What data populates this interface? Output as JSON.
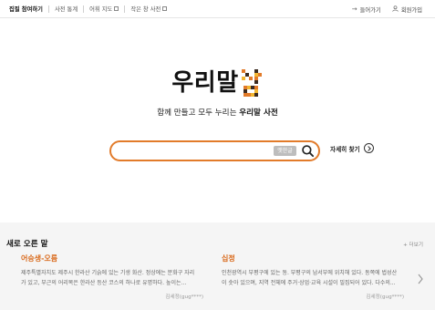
{
  "nav": {
    "items": [
      {
        "label": "집필 참여하기",
        "active": true
      },
      {
        "label": "사전 통계",
        "active": false
      },
      {
        "label": "어휘 지도",
        "active": false,
        "external": true
      },
      {
        "label": "작은 창 사전",
        "active": false,
        "external": true
      }
    ],
    "login": "들어가기",
    "signup": "회원가입"
  },
  "logo": {
    "text": "우리말",
    "mark": "샘",
    "colors": {
      "orange": "#e27b2a",
      "yellow": "#f2b632",
      "dark": "#3a2a20"
    }
  },
  "tagline": {
    "plain": "함께 만들고 모두 누리는 ",
    "bold": "우리말 사전"
  },
  "search": {
    "value": "",
    "placeholder": "",
    "hanja_button": "옛한글",
    "accent": "#e27b2a"
  },
  "detail_search": "자세히 찾기",
  "new_words": {
    "title": "새로 오른 말",
    "more": "+ 더보기",
    "cards": [
      {
        "word": "어승생-오름",
        "desc_lines": [
          "제주특별자치도 제주시 한라산 기슭에 있는 기생 화산. 정상에는 분화구 자리",
          "가 있고, 부근의 어리목은 한라산 등산 코스의 하나로 유명하다. 높이는..."
        ],
        "author": "김세정(gug****)"
      },
      {
        "word": "십정",
        "desc_lines": [
          "인천광역시 부평구에 있는 동. 부평구의 남서부에 위치해 있다. 동쪽에 법성산",
          "이 솟아 있으며, 지역 전체에 주거·상업·교육 시설이 밀집되어 있다. 다수의..."
        ],
        "author": "김세정(gug****)"
      }
    ]
  }
}
